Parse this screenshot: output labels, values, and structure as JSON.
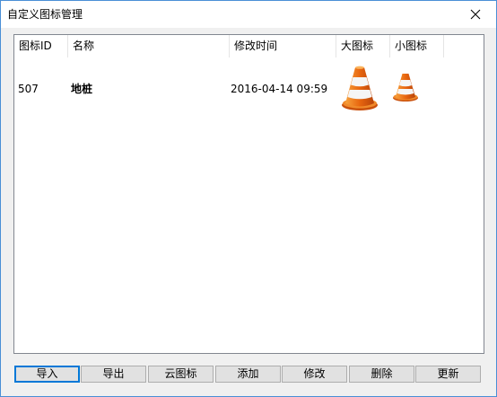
{
  "window": {
    "title": "自定义图标管理"
  },
  "columns": [
    {
      "label": "图标ID"
    },
    {
      "label": "名称"
    },
    {
      "label": "修改时间"
    },
    {
      "label": "大图标"
    },
    {
      "label": "小图标"
    }
  ],
  "rows": [
    {
      "id": "507",
      "name": "地桩",
      "modified": "2016-04-14 09:59",
      "large_icon": "traffic-cone-icon",
      "small_icon": "traffic-cone-icon"
    }
  ],
  "buttons": {
    "import": "导入",
    "export": "导出",
    "cloud": "云图标",
    "add": "添加",
    "modify": "修改",
    "delete": "删除",
    "update": "更新"
  },
  "colors": {
    "window_border": "#4a8fd6",
    "dialog_bg": "#f0f0f0",
    "default_button_border": "#0078d7",
    "cone_orange": "#e8660f",
    "cone_white": "#ffffff"
  }
}
